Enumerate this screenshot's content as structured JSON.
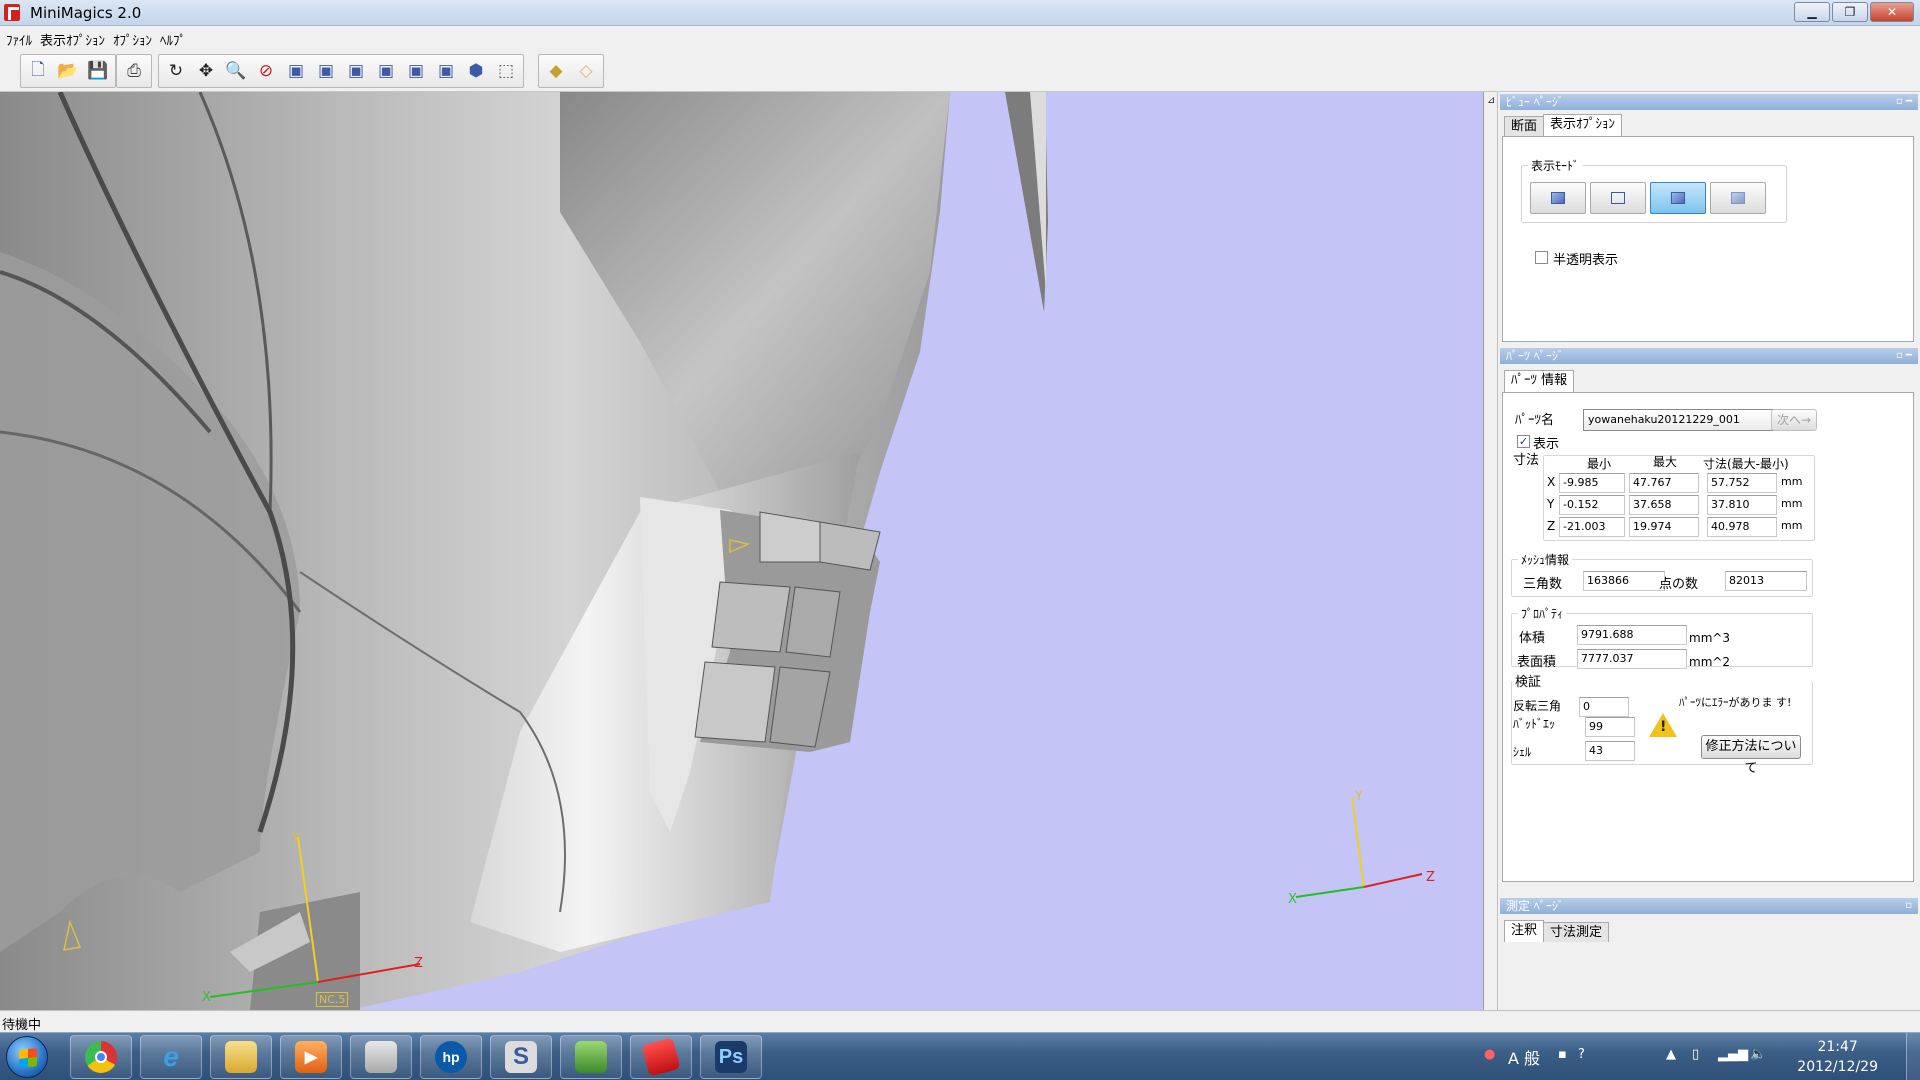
{
  "window": {
    "title": "MiniMagics 2.0"
  },
  "menu": [
    "ﾌｧｲﾙ",
    "表示ｵﾌﾟｼｮﾝ",
    "ｵﾌﾟｼｮﾝ",
    "ﾍﾙﾌﾟ"
  ],
  "toolbar": {
    "file_icons": [
      "new-file-icon",
      "open-folder-icon",
      "save-icon"
    ],
    "print_icons": [
      "print-icon"
    ],
    "view_icons": [
      "rotate-icon",
      "pan-icon",
      "zoom-icon",
      "zoom-fit-icon",
      "view-front-icon",
      "view-back-icon",
      "view-left-icon",
      "view-right-icon",
      "view-top-icon",
      "view-bottom-icon",
      "view-iso-icon",
      "view-camera-icon"
    ],
    "extra_icons": [
      "measure-icon",
      "eraser-icon"
    ]
  },
  "viewport": {
    "background": "#c4c4f6",
    "coord_tag": "NC.5",
    "axis_labels": {
      "x": "X",
      "y": "Y",
      "z": "Z"
    }
  },
  "view_page": {
    "header": "ﾋﾞｭｰ ﾍﾟｰｼﾞ",
    "tabs": [
      "断面",
      "表示ｵﾌﾟｼｮﾝ"
    ],
    "active_tab": 1,
    "display_mode_title": "表示ﾓｰﾄﾞ",
    "modes": [
      "shaded-mode-icon",
      "wireframe-mode-icon",
      "shaded-edges-mode-icon",
      "transparent-mode-icon"
    ],
    "active_mode": 2,
    "translucent_label": "半透明表示",
    "translucent_checked": false
  },
  "parts_page": {
    "header": "ﾊﾟｰﾂ ﾍﾟｰｼﾞ",
    "tab": "ﾊﾟｰﾂ 情報",
    "part_name_label": "ﾊﾟｰﾂ名",
    "part_name_value": "yowanehaku20121229_001",
    "next_button": "次へ→",
    "show_label": "表示",
    "show_checked": true,
    "dimensions_label": "寸法",
    "dim_headers": [
      "最小",
      "最大",
      "寸法(最大-最小)"
    ],
    "dims": [
      {
        "axis": "X",
        "min": "-9.985",
        "max": "47.767",
        "size": "57.752",
        "unit": "mm"
      },
      {
        "axis": "Y",
        "min": "-0.152",
        "max": "37.658",
        "size": "37.810",
        "unit": "mm"
      },
      {
        "axis": "Z",
        "min": "-21.003",
        "max": "19.974",
        "size": "40.978",
        "unit": "mm"
      }
    ],
    "mesh_info_title": "ﾒｯｼｭ情報",
    "triangles_label": "三角数",
    "triangles_value": "163866",
    "points_label": "点の数",
    "points_value": "82013",
    "property_title": "ﾌﾟﾛﾊﾟﾃｨ",
    "volume_label": "体積",
    "volume_value": "9791.688",
    "volume_unit": "mm^3",
    "area_label": "表面積",
    "area_value": "7777.037",
    "area_unit": "mm^2",
    "verify_title": "検証",
    "inverted_label": "反転三角",
    "inverted_value": "0",
    "bad_edges_label": "ﾊﾞｯﾄﾞｴｯ",
    "bad_edges_value": "99",
    "shells_label": "ｼｪﾙ",
    "shells_value": "43",
    "error_message": "ﾊﾟｰﾂにｴﾗｰがありま す!",
    "fix_button": "修正方法について"
  },
  "measure_page": {
    "header": "測定 ﾍﾟｰｼﾞ",
    "tabs": [
      "注釈",
      "寸法測定"
    ]
  },
  "status": {
    "text": "待機中"
  },
  "taskbar": {
    "apps": [
      "chrome-icon",
      "internet-explorer-icon",
      "file-explorer-icon",
      "media-player-icon",
      "printer-app-icon",
      "hp-icon",
      "sai-icon",
      "fern-app-icon",
      "minimagics-icon",
      "photoshop-icon"
    ],
    "ime": "A 般",
    "clock_time": "21:47",
    "clock_date": "2012/12/29"
  }
}
